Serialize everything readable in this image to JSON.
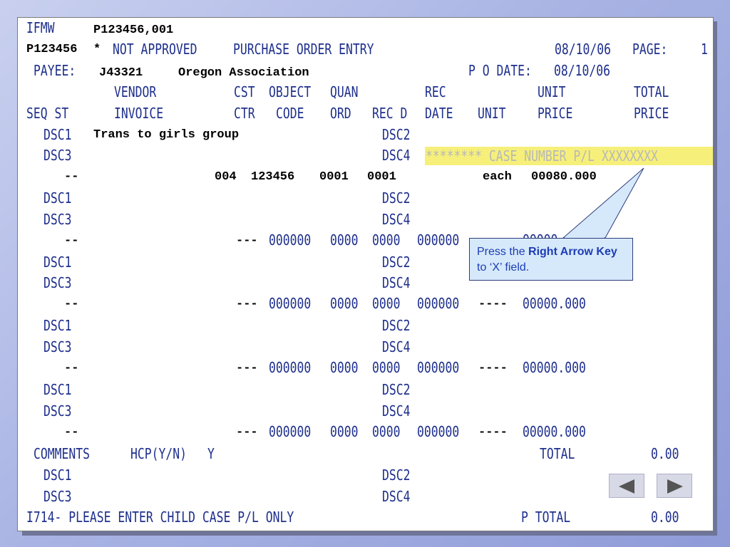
{
  "screen": {
    "program_id": "IFMW",
    "record_key": "P123456,001",
    "po_number": "P123456",
    "status_flag": "*",
    "status_text": "NOT APPROVED",
    "screen_title": "PURCHASE ORDER ENTRY",
    "date": "08/10/06",
    "page_label": "PAGE:",
    "page_number": "1",
    "payee_label": "PAYEE:",
    "payee_id": "J43321",
    "payee_name": "Oregon Association",
    "po_date_label": "P O DATE:",
    "po_date": "08/10/06"
  },
  "headers": {
    "vendor": "VENDOR",
    "cst": "CST",
    "object": "OBJECT",
    "quan": "QUAN",
    "rec": "REC",
    "unit_top": "UNIT",
    "total": "TOTAL",
    "seq_st": "SEQ ST",
    "invoice": "INVOICE",
    "ctr": "CTR",
    "code": "CODE",
    "ord": "ORD",
    "rec_d": "REC D",
    "date": "DATE",
    "unit": "UNIT",
    "price": "PRICE",
    "total_price": "PRICE"
  },
  "labels": {
    "dsc1": "DSC1",
    "dsc2": "DSC2",
    "dsc3": "DSC3",
    "dsc4": "DSC4",
    "seq": "--",
    "cst_blank": "---",
    "object_zero": "000000",
    "quan_zero": "0000",
    "rec_zero": "0000",
    "date_zero": "000000",
    "unit_blank": "----",
    "price_zero": "00000.000"
  },
  "line1": {
    "dsc1_text": "Trans to girls group",
    "dsc4_text": "******** CASE NUMBER P/L XXXXXXXX",
    "cst": "004",
    "object": "123456",
    "quan": "0001",
    "rec": "0001",
    "unit": "each",
    "price": "00080.000"
  },
  "footer": {
    "comments_label": "COMMENTS",
    "hcp_label": "HCP(Y/N)",
    "hcp_value": "Y",
    "total_label": "TOTAL",
    "total_value": "0.00",
    "message": "I714- PLEASE ENTER CHILD CASE P/L ONLY",
    "p_total_label": "P TOTAL",
    "p_total_value": "0.00"
  },
  "callout": {
    "prefix": "Press the ",
    "bold": "Right Arrow Key",
    "suffix": " to ‘X’ field."
  },
  "nav": {
    "prev_icon": "triangle-left-icon",
    "next_icon": "triangle-right-icon"
  }
}
